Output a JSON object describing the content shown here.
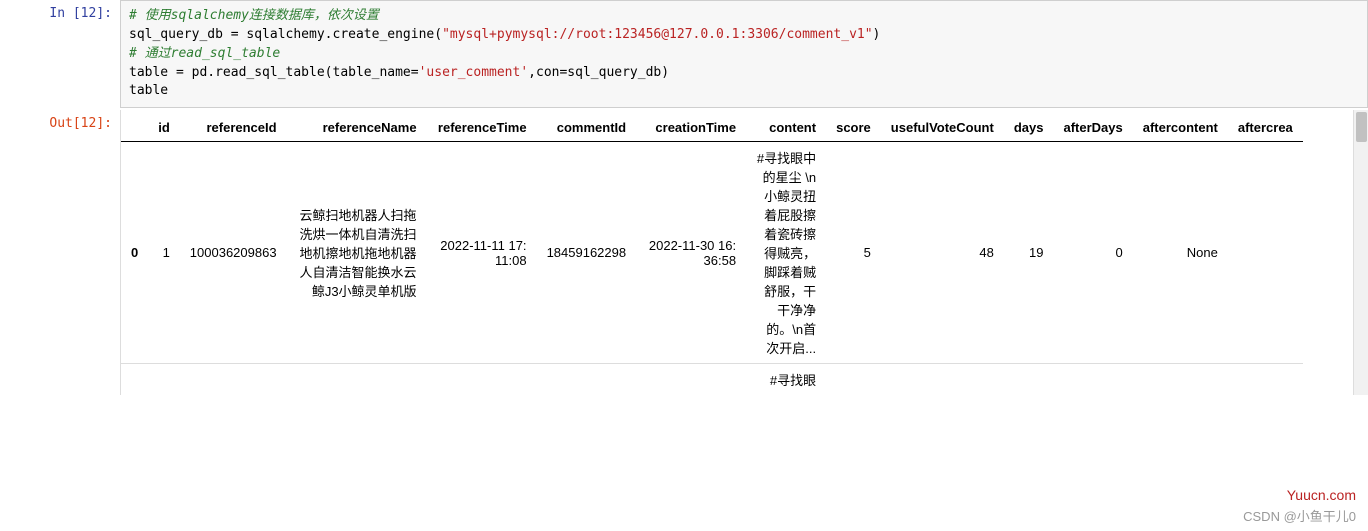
{
  "prompts": {
    "in": "In [12]:",
    "out": "Out[12]:"
  },
  "code": {
    "line1": "# 使用sqlalchemy连接数据库，依次设置",
    "line2a": "sql_query_db = sqlalchemy.create_engine(",
    "line2b": "\"mysql+pymysql://root:123456@127.0.0.1:3306/comment_v1\"",
    "line2c": ")",
    "line3": "# 通过read_sql_table",
    "line4a": "table = pd.read_sql_table(table_name=",
    "line4b": "'user_comment'",
    "line4c": ",con=sql_query_db)",
    "line5": "table"
  },
  "table": {
    "columns": [
      "",
      "id",
      "referenceId",
      "referenceName",
      "referenceTime",
      "commentId",
      "creationTime",
      "content",
      "score",
      "usefulVoteCount",
      "days",
      "afterDays",
      "aftercontent",
      "aftercrea"
    ],
    "rows": [
      {
        "index": "0",
        "id": "1",
        "referenceId": "100036209863",
        "referenceName": "云鲸扫地机器人扫拖洗烘一体机自清洗扫地机擦地机拖地机器人自清洁智能换水云鲸J3小鲸灵单机版",
        "referenceTime": "2022-11-11 17:11:08",
        "commentId": "18459162298",
        "creationTime": "2022-11-30 16:36:58",
        "content": "#寻找眼中的星尘 \\n小鲸灵扭着屁股擦着瓷砖擦得贼亮，脚踩着贼舒服，干干净净的。\\n首次开启...",
        "score": "5",
        "usefulVoteCount": "48",
        "days": "19",
        "afterDays": "0",
        "aftercontent": "None",
        "aftercrea": ""
      }
    ],
    "partial_next_row": {
      "content": "#寻找眼"
    }
  },
  "watermarks": {
    "site": "Yuucn.com",
    "csdn": "CSDN @小鱼干儿0"
  }
}
